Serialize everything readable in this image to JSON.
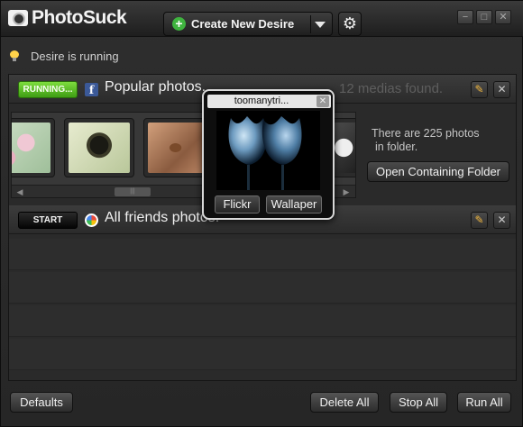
{
  "app": {
    "name": "PhotoSuck"
  },
  "toolbar": {
    "create_label": "Create New Desire",
    "plus_icon": "plus-circle-icon",
    "settings_icon": "gear-icon"
  },
  "window_controls": {
    "minimize": "−",
    "maximize": "□",
    "close": "✕"
  },
  "status": {
    "text": "Desire is running",
    "icon": "lightbulb-icon"
  },
  "desires": [
    {
      "state_label": "RUNNING...",
      "source_icon": "facebook-icon",
      "source_glyph": "f",
      "title": "Popular photos.",
      "medias_found": "12 medias found.",
      "folder_info_line1": "There are 225 photos",
      "folder_info_line2": "in folder.",
      "open_folder_label": "Open Containing Folder",
      "thumbnails": [
        "pink-flowers",
        "dandelion-silhouette",
        "hummingbird",
        "bw-photo"
      ]
    },
    {
      "state_label": "START",
      "source_icon": "picasa-icon",
      "title": "All friends photos."
    }
  ],
  "popup": {
    "title": "toomanytri...",
    "image": "tulip-photo",
    "button_1": "Flickr",
    "button_2": "Wallaper"
  },
  "footer": {
    "defaults": "Defaults",
    "delete_all": "Delete All",
    "stop_all": "Stop All",
    "run_all": "Run All"
  },
  "colors": {
    "accent_green": "#4cb520",
    "background": "#262626"
  }
}
